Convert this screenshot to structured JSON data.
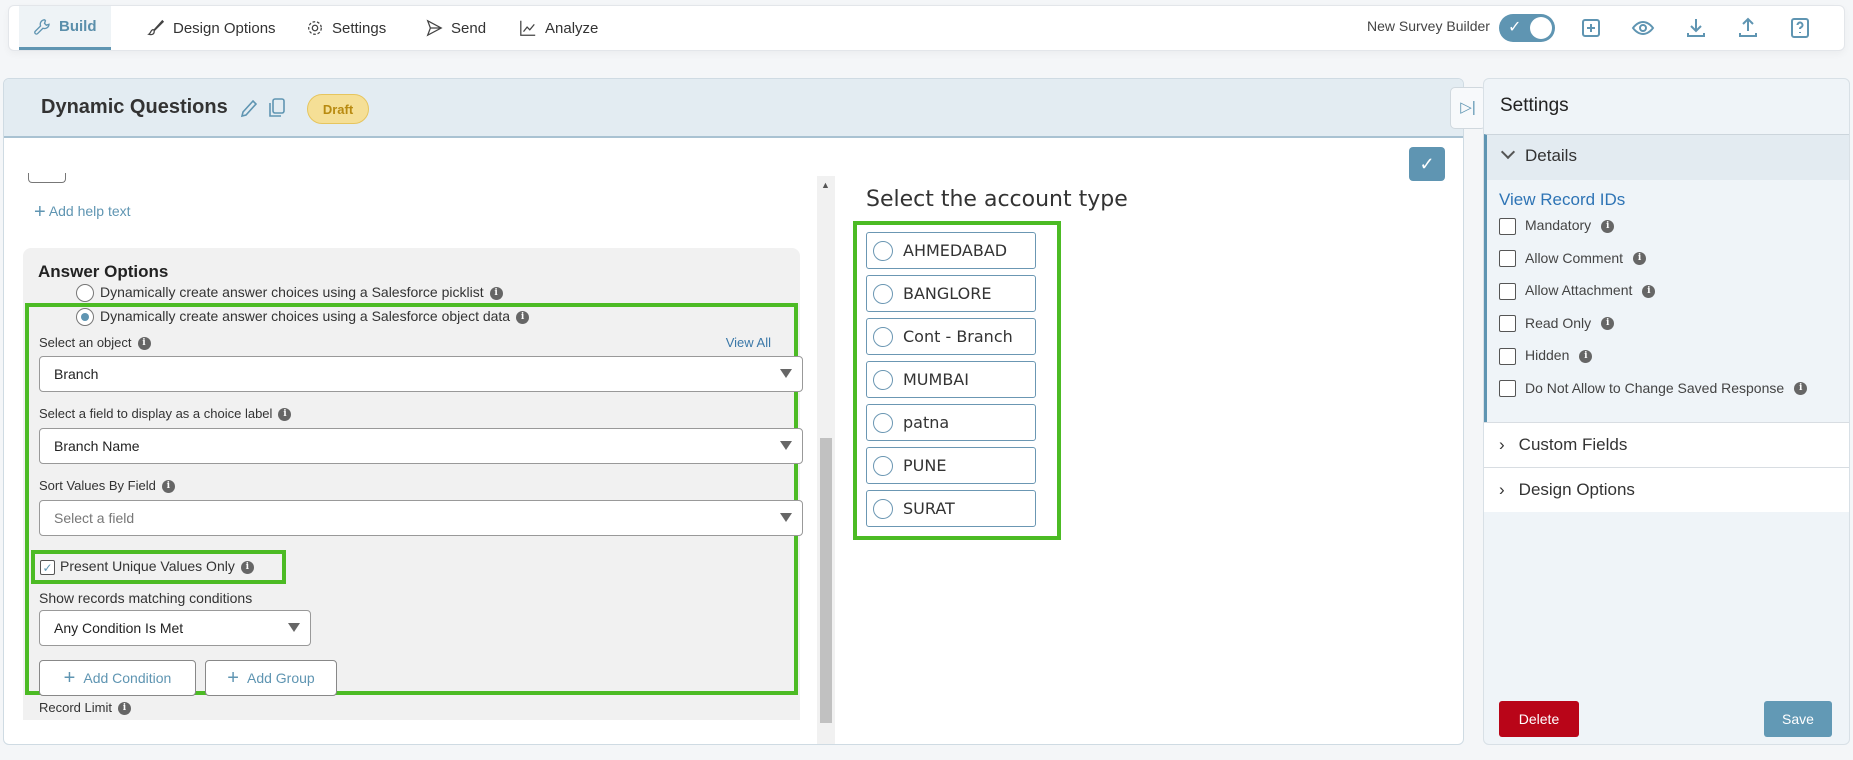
{
  "nav": {
    "tabs": [
      "Build",
      "Design Options",
      "Settings",
      "Send",
      "Analyze"
    ],
    "new_builder_label": "New Survey Builder",
    "new_builder_on": true
  },
  "header": {
    "title": "Dynamic Questions",
    "status": "Draft"
  },
  "form": {
    "add_help_text": "Add help text",
    "answer_options_title": "Answer Options",
    "radio_picklist": "Dynamically create answer choices using a Salesforce picklist",
    "radio_object": "Dynamically create answer choices using a Salesforce object data",
    "select_object_label": "Select an object",
    "view_all": "View All",
    "object_value": "Branch",
    "field_label": "Select a field to display as a choice label",
    "field_value": "Branch Name",
    "sort_label": "Sort Values By Field",
    "sort_placeholder": "Select a field",
    "unique_label": "Present Unique Values Only",
    "unique_checked": true,
    "conditions_label": "Show records matching conditions",
    "conditions_value": "Any Condition Is Met",
    "add_condition": "Add Condition",
    "add_group": "Add Group",
    "record_limit": "Record Limit"
  },
  "preview": {
    "question": "Select the account type",
    "options": [
      "AHMEDABAD",
      "BANGLORE",
      "Cont - Branch",
      "MUMBAI",
      "patna",
      "PUNE",
      "SURAT"
    ]
  },
  "settings": {
    "title": "Settings",
    "details": "Details",
    "view_record_ids": "View Record IDs",
    "checkboxes": [
      "Mandatory",
      "Allow Comment",
      "Allow Attachment",
      "Read Only",
      "Hidden",
      "Do Not Allow to Change Saved Response"
    ],
    "custom_fields": "Custom Fields",
    "design_options": "Design Options",
    "delete": "Delete",
    "save": "Save"
  },
  "colors": {
    "accent": "#5f95b2",
    "highlight": "#4cbb24",
    "delete": "#b90518"
  }
}
